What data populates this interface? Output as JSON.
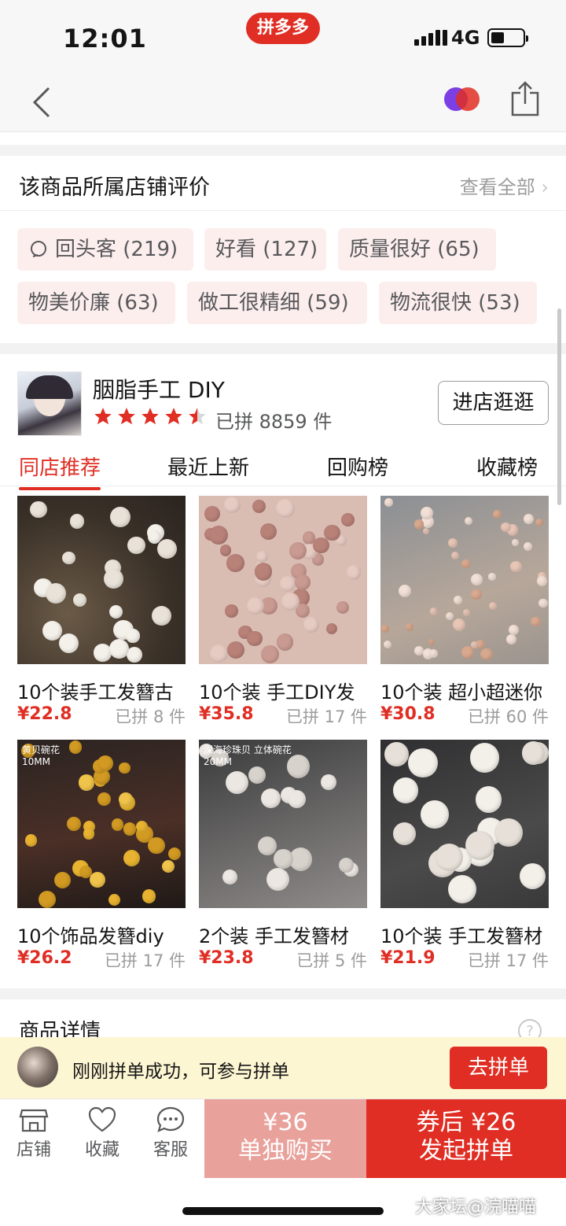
{
  "status_bar": {
    "time": "12:01",
    "app_badge": "拼多多",
    "network": "4G"
  },
  "reviews": {
    "title": "该商品所属店铺评价",
    "view_all": "查看全部",
    "tags": [
      "回头客 (219)",
      "好看 (127)",
      "质量很好 (65)",
      "物美价廉 (63)",
      "做工很精细 (59)",
      "物流很快 (53)"
    ]
  },
  "store": {
    "name": "胭脂手工 DIY",
    "rating": 4.5,
    "sold": "已拼 8859 件",
    "visit_button": "进店逛逛"
  },
  "tabs": [
    "同店推荐",
    "最近上新",
    "回购榜",
    "收藏榜"
  ],
  "products": [
    {
      "title": "10个装手工发簪古",
      "price": "¥22.8",
      "sold": "已拼 8 件",
      "image_label": ""
    },
    {
      "title": "10个装 手工DIY发",
      "price": "¥35.8",
      "sold": "已拼 17 件",
      "image_label": ""
    },
    {
      "title": "10个装 超小超迷你",
      "price": "¥30.8",
      "sold": "已拼 60 件",
      "image_label": ""
    },
    {
      "title": "10个饰品发簪diy",
      "price": "¥26.2",
      "sold": "已拼 17 件",
      "image_label": "黄贝碗花\n10MM"
    },
    {
      "title": "2个装 手工发簪材",
      "price": "¥23.8",
      "sold": "已拼 5 件",
      "image_label": "深海珍珠贝 立体碗花\n20MM"
    },
    {
      "title": "10个装 手工发簪材",
      "price": "¥21.9",
      "sold": "已拼 17 件",
      "image_label": ""
    }
  ],
  "details": {
    "title": "商品详情"
  },
  "group_banner": {
    "text": "刚刚拼单成功，可参与拼单",
    "button": "去拼单"
  },
  "bottom_bar": {
    "store": "店铺",
    "favorite": "收藏",
    "service": "客服",
    "single_price": "¥36",
    "single_label": "单独购买",
    "group_price": "券后 ¥26",
    "group_label": "发起拼单"
  },
  "watermark": "大家坛@浣喵喵",
  "colors": {
    "brand": "#e02e24",
    "single_buy": "#e9a19b",
    "tag_bg": "#fdeeee",
    "banner_bg": "#fdf6d2"
  }
}
